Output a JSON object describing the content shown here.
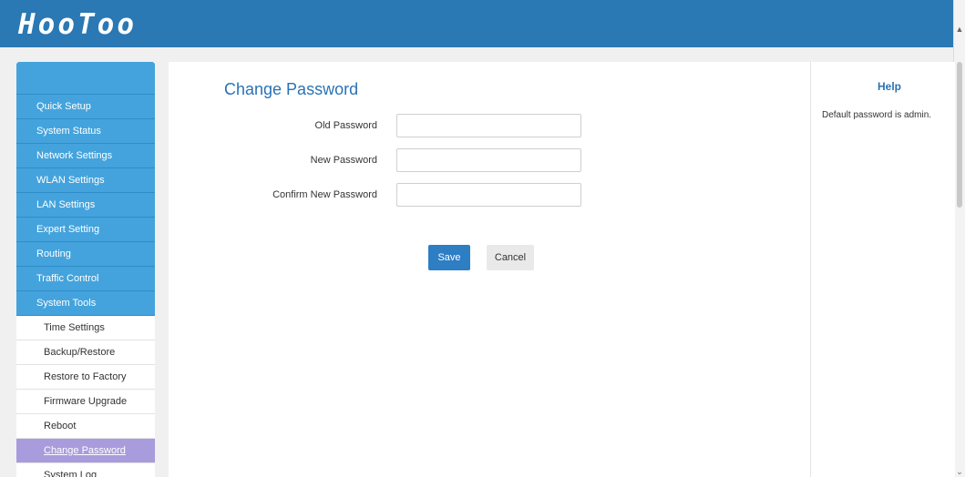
{
  "header": {
    "logo": "HooToo"
  },
  "sidebar": {
    "nav": [
      {
        "label": "Quick Setup"
      },
      {
        "label": "System Status"
      },
      {
        "label": "Network Settings"
      },
      {
        "label": "WLAN Settings"
      },
      {
        "label": "LAN Settings"
      },
      {
        "label": "Expert Setting"
      },
      {
        "label": "Routing"
      },
      {
        "label": "Traffic Control"
      },
      {
        "label": "System Tools"
      }
    ],
    "sub": [
      {
        "label": "Time Settings"
      },
      {
        "label": "Backup/Restore"
      },
      {
        "label": "Restore to Factory"
      },
      {
        "label": "Firmware Upgrade"
      },
      {
        "label": "Reboot"
      },
      {
        "label": "Change Password",
        "active": true
      },
      {
        "label": "System Log"
      }
    ]
  },
  "main": {
    "title": "Change Password",
    "fields": [
      {
        "label": "Old Password",
        "value": ""
      },
      {
        "label": "New Password",
        "value": ""
      },
      {
        "label": "Confirm New Password",
        "value": ""
      }
    ],
    "save_label": "Save",
    "cancel_label": "Cancel"
  },
  "help": {
    "title": "Help",
    "text": "Default password is admin."
  },
  "icons": {
    "scroll_up": "chevron-up-icon",
    "scroll_down": "chevron-down-icon"
  },
  "colors": {
    "header": "#2a78b4",
    "nav": "#44a3dc",
    "active_sub": "#a99cdc",
    "accent_text": "#2a72b5",
    "save_button": "#2e7ec4"
  }
}
